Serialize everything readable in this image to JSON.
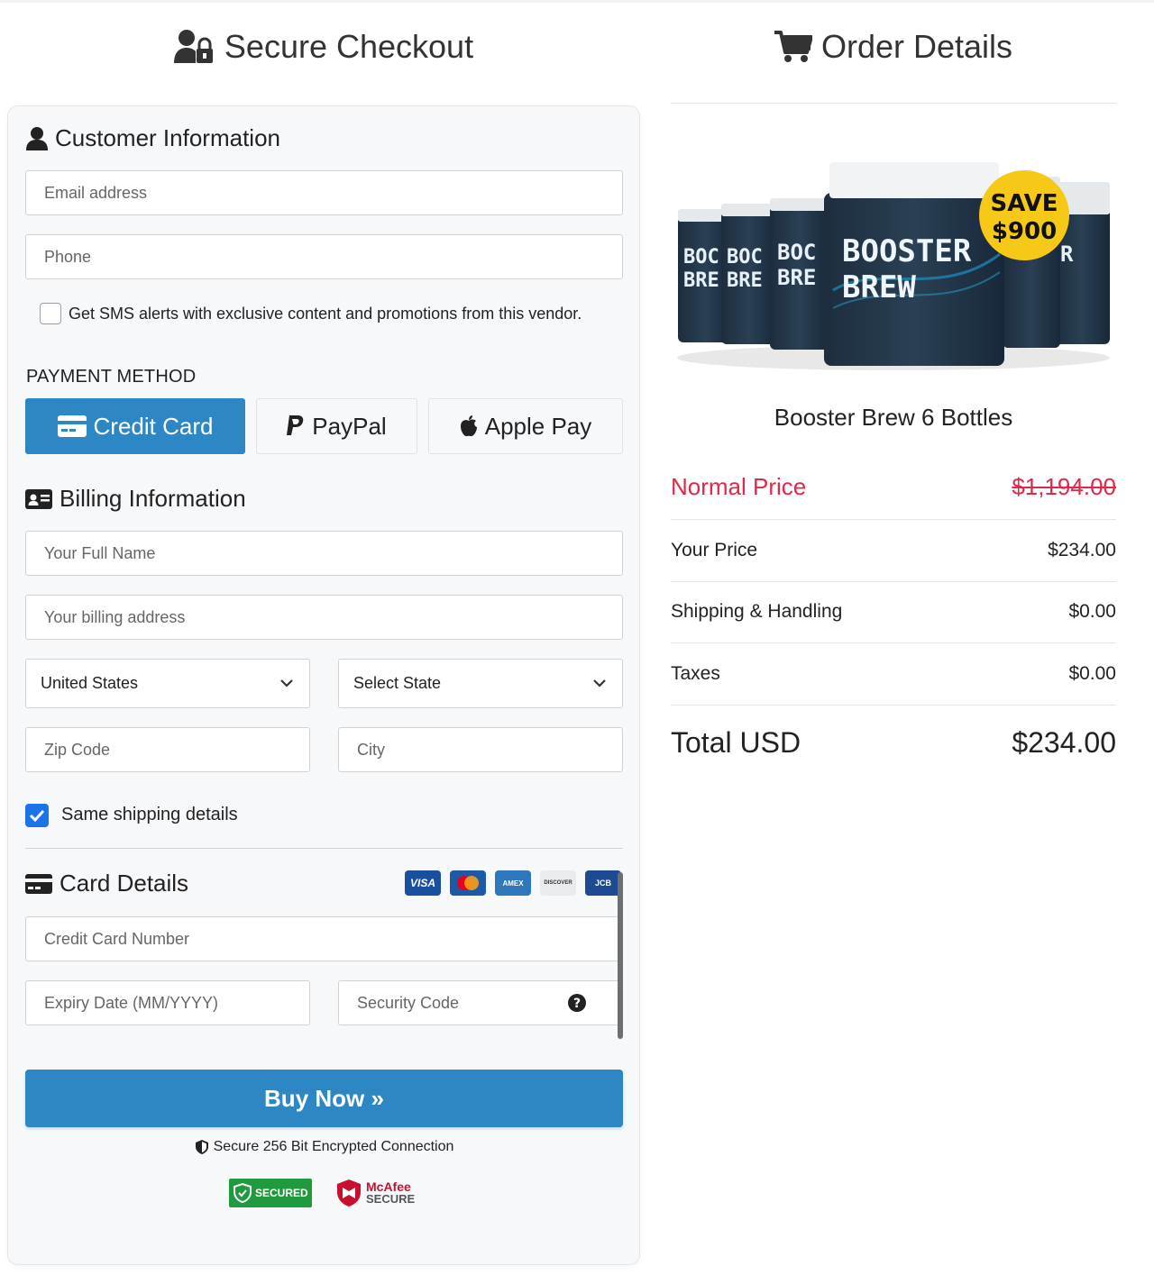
{
  "header": {
    "left_title": "Secure Checkout",
    "right_title": "Order Details"
  },
  "customer": {
    "title": "Customer Information",
    "email_placeholder": "Email address",
    "phone_placeholder": "Phone",
    "sms_label": "Get SMS alerts with exclusive content and promotions from this vendor.",
    "sms_checked": false
  },
  "payment": {
    "label": "PAYMENT METHOD",
    "methods": [
      {
        "label": "Credit Card",
        "active": true
      },
      {
        "label": "PayPal",
        "active": false
      },
      {
        "label": "Apple Pay",
        "active": false
      }
    ]
  },
  "billing": {
    "title": "Billing Information",
    "full_name_placeholder": "Your Full Name",
    "address_placeholder": "Your billing address",
    "country_value": "United States",
    "state_value": "Select State",
    "zip_placeholder": "Zip Code",
    "city_placeholder": "City",
    "same_shipping_label": "Same shipping details",
    "same_shipping_checked": true
  },
  "card_details": {
    "title": "Card Details",
    "logos": [
      "VISA",
      "MASTERCARD",
      "AMEX",
      "DISCOVER",
      "JCB"
    ],
    "number_placeholder": "Credit Card Number",
    "expiry_placeholder": "Expiry Date (MM/YYYY)",
    "cvv_placeholder": "Security Code"
  },
  "actions": {
    "buy_label": "Buy Now »",
    "secure_text": "Secure 256 Bit Encrypted Connection",
    "badge_secured": "SECURED",
    "badge_mcafee_line1": "McAfee",
    "badge_mcafee_line2": "SECURE"
  },
  "order": {
    "badge_line1": "SAVE",
    "badge_line2": "$900",
    "bottle_brand_line1": "BOOSTER",
    "bottle_brand_line2": "BREW",
    "product_name": "Booster Brew 6 Bottles",
    "normal_label": "Normal Price",
    "normal_value": "$1,194.00",
    "your_price_label": "Your Price",
    "your_price_value": "$234.00",
    "shipping_label": "Shipping & Handling",
    "shipping_value": "$0.00",
    "taxes_label": "Taxes",
    "taxes_value": "$0.00",
    "total_label": "Total USD",
    "total_value": "$234.00"
  },
  "colors": {
    "primary": "#2d87c4",
    "strike_red": "#e0294a",
    "checkbox_blue": "#1a73e8",
    "badge_yellow": "#f6c919"
  }
}
